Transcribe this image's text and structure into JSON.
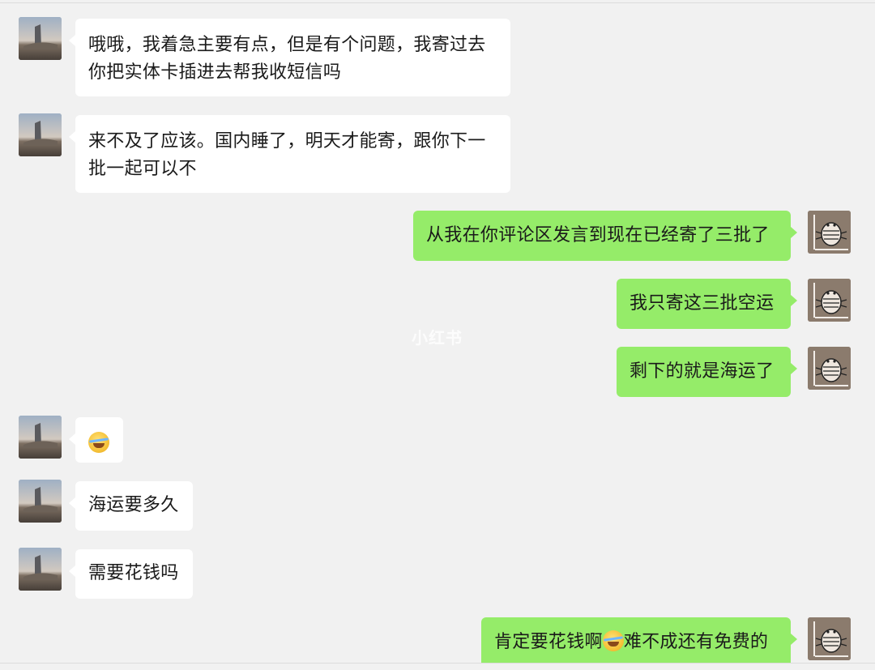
{
  "watermark": "小红书",
  "messages": [
    {
      "side": "left",
      "text_line1": "哦哦，我着急主要有点，但是有个问题，我寄过去",
      "text_line2": "你把实体卡插进去帮我收短信吗"
    },
    {
      "side": "left",
      "text_line1": "来不及了应该。国内睡了，明天才能寄，跟你下一",
      "text_line2": "批一起可以不"
    },
    {
      "side": "right",
      "text": "从我在你评论区发言到现在已经寄了三批了"
    },
    {
      "side": "right",
      "text": "我只寄这三批空运"
    },
    {
      "side": "right",
      "text": "剩下的就是海运了"
    },
    {
      "side": "left",
      "emoji": "laughing-crying-emoji"
    },
    {
      "side": "left",
      "text": "海运要多久"
    },
    {
      "side": "left",
      "text": "需要花钱吗"
    },
    {
      "side": "right",
      "text_before": "肯定要花钱啊",
      "emoji": "laughing-crying-emoji",
      "text_after": "难不成还有免费的"
    }
  ],
  "colors": {
    "background": "#f1f1f1",
    "bubble_left": "#ffffff",
    "bubble_right": "#95ec69"
  }
}
